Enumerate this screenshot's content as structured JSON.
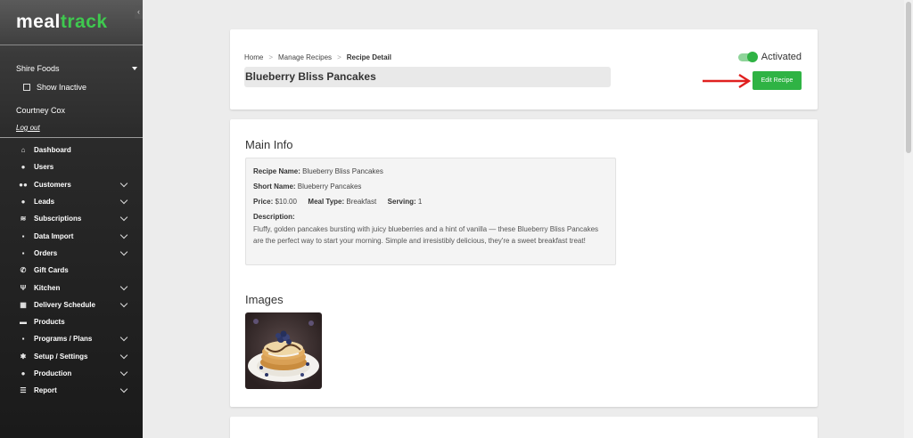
{
  "app": {
    "logo_part1": "meal",
    "logo_part2": "track",
    "collapse_icon": "chevron-left-icon"
  },
  "sidebar": {
    "company": "Shire Foods",
    "show_inactive_label": "Show Inactive",
    "user_name": "Courtney Cox",
    "logout_label": "Log out",
    "items": [
      {
        "label": "Dashboard",
        "icon": "home-icon",
        "glyph": "⌂",
        "has_children": false
      },
      {
        "label": "Users",
        "icon": "user-icon",
        "glyph": "●",
        "has_children": false
      },
      {
        "label": "Customers",
        "icon": "users-icon",
        "glyph": "●●",
        "has_children": true
      },
      {
        "label": "Leads",
        "icon": "info-icon",
        "glyph": "●",
        "has_children": true
      },
      {
        "label": "Subscriptions",
        "icon": "layers-icon",
        "glyph": "≋",
        "has_children": true
      },
      {
        "label": "Data Import",
        "icon": "file-icon",
        "glyph": "▪",
        "has_children": true
      },
      {
        "label": "Orders",
        "icon": "shopping-bag-icon",
        "glyph": "▪",
        "has_children": true
      },
      {
        "label": "Gift Cards",
        "icon": "phone-icon",
        "glyph": "✆",
        "has_children": false
      },
      {
        "label": "Kitchen",
        "icon": "utensils-icon",
        "glyph": "Ψ",
        "has_children": true
      },
      {
        "label": "Delivery Schedule",
        "icon": "calendar-icon",
        "glyph": "▦",
        "has_children": true
      },
      {
        "label": "Products",
        "icon": "box-icon",
        "glyph": "▬",
        "has_children": false
      },
      {
        "label": "Programs / Plans",
        "icon": "clipboard-icon",
        "glyph": "▪",
        "has_children": true
      },
      {
        "label": "Setup / Settings",
        "icon": "gear-icon",
        "glyph": "✱",
        "has_children": true
      },
      {
        "label": "Production",
        "icon": "person-icon",
        "glyph": "●",
        "has_children": true
      },
      {
        "label": "Report",
        "icon": "list-icon",
        "glyph": "☰",
        "has_children": true
      }
    ]
  },
  "header": {
    "breadcrumb": [
      "Home",
      "Manage Recipes",
      "Recipe Detail"
    ],
    "breadcrumb_sep": ">",
    "title": "Blueberry Bliss Pancakes",
    "status_label": "Activated",
    "status_active": true,
    "edit_button_label": "Edit Recipe"
  },
  "main_info": {
    "section_title": "Main Info",
    "recipe_name_label": "Recipe Name:",
    "recipe_name": "Blueberry Bliss Pancakes",
    "short_name_label": "Short Name:",
    "short_name": "Blueberry Pancakes",
    "price_label": "Price:",
    "price": "$10.00",
    "meal_type_label": "Meal Type:",
    "meal_type": "Breakfast",
    "serving_label": "Serving:",
    "serving": "1",
    "description_label": "Description:",
    "description": "Fluffy, golden pancakes bursting with juicy blueberries and a hint of vanilla — these Blueberry Bliss Pancakes are the perfect way to start your morning. Simple and irresistibly delicious, they're a sweet breakfast treat!"
  },
  "images": {
    "section_title": "Images"
  },
  "colors": {
    "accent": "#2fb344",
    "annotation_arrow": "#e0201f"
  }
}
